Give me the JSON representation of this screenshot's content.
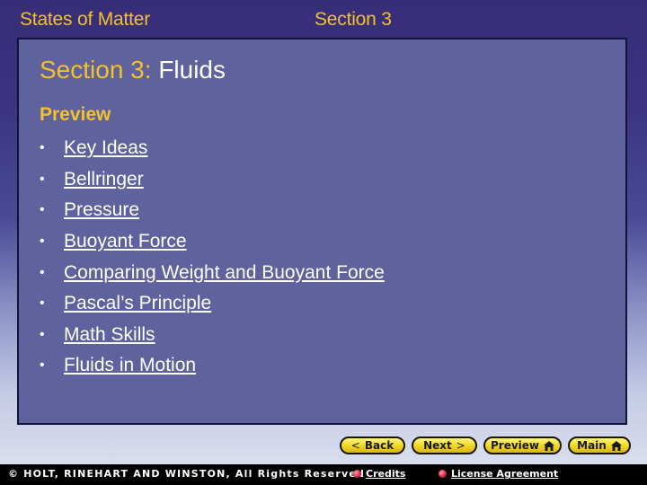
{
  "header": {
    "chapter_title": "States of Matter",
    "section_label": "Section 3"
  },
  "panel": {
    "title_prefix": "Section 3:",
    "title_main": "Fluids",
    "preview_label": "Preview",
    "links": [
      {
        "label": "Key Ideas"
      },
      {
        "label": "Bellringer"
      },
      {
        "label": "Pressure"
      },
      {
        "label": "Buoyant Force"
      },
      {
        "label": "Comparing Weight and Buoyant Force"
      },
      {
        "label": "Pascal’s Principle"
      },
      {
        "label": "Math Skills"
      },
      {
        "label": "Fluids in Motion"
      }
    ],
    "bullet": "•"
  },
  "nav": {
    "back": {
      "label": "Back",
      "icon": "chevron-left-icon",
      "glyph": "<"
    },
    "next": {
      "label": "Next",
      "icon": "chevron-right-icon",
      "glyph": ">"
    },
    "preview": {
      "label": "Preview",
      "icon": "home-icon"
    },
    "main": {
      "label": "Main",
      "icon": "home-icon"
    }
  },
  "footer": {
    "copyright": "© HOLT, RINEHART AND WINSTON, All Rights Reserved",
    "credits": "Credits",
    "license": "License Agreement"
  },
  "colors": {
    "accent_yellow": "#f2c22c",
    "panel_bg": "#5f629c",
    "button_yellow": "#f3dc2a"
  }
}
